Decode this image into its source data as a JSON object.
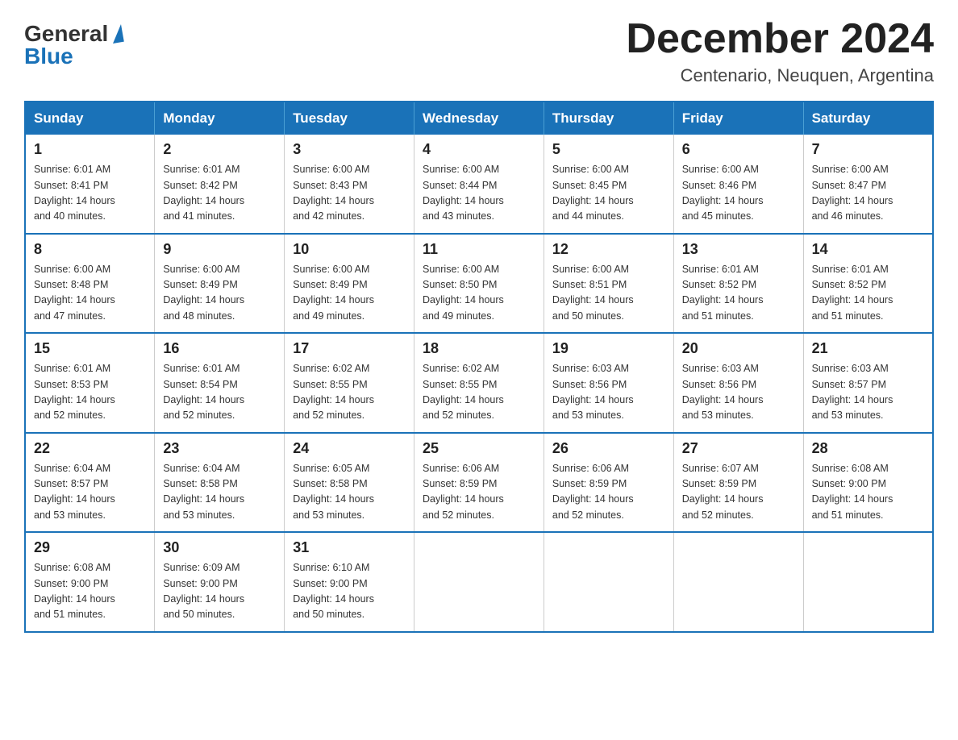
{
  "logo": {
    "general": "General",
    "blue": "Blue"
  },
  "title": "December 2024",
  "subtitle": "Centenario, Neuquen, Argentina",
  "days_of_week": [
    "Sunday",
    "Monday",
    "Tuesday",
    "Wednesday",
    "Thursday",
    "Friday",
    "Saturday"
  ],
  "weeks": [
    [
      {
        "day": "1",
        "sunrise": "6:01 AM",
        "sunset": "8:41 PM",
        "daylight": "14 hours and 40 minutes."
      },
      {
        "day": "2",
        "sunrise": "6:01 AM",
        "sunset": "8:42 PM",
        "daylight": "14 hours and 41 minutes."
      },
      {
        "day": "3",
        "sunrise": "6:00 AM",
        "sunset": "8:43 PM",
        "daylight": "14 hours and 42 minutes."
      },
      {
        "day": "4",
        "sunrise": "6:00 AM",
        "sunset": "8:44 PM",
        "daylight": "14 hours and 43 minutes."
      },
      {
        "day": "5",
        "sunrise": "6:00 AM",
        "sunset": "8:45 PM",
        "daylight": "14 hours and 44 minutes."
      },
      {
        "day": "6",
        "sunrise": "6:00 AM",
        "sunset": "8:46 PM",
        "daylight": "14 hours and 45 minutes."
      },
      {
        "day": "7",
        "sunrise": "6:00 AM",
        "sunset": "8:47 PM",
        "daylight": "14 hours and 46 minutes."
      }
    ],
    [
      {
        "day": "8",
        "sunrise": "6:00 AM",
        "sunset": "8:48 PM",
        "daylight": "14 hours and 47 minutes."
      },
      {
        "day": "9",
        "sunrise": "6:00 AM",
        "sunset": "8:49 PM",
        "daylight": "14 hours and 48 minutes."
      },
      {
        "day": "10",
        "sunrise": "6:00 AM",
        "sunset": "8:49 PM",
        "daylight": "14 hours and 49 minutes."
      },
      {
        "day": "11",
        "sunrise": "6:00 AM",
        "sunset": "8:50 PM",
        "daylight": "14 hours and 49 minutes."
      },
      {
        "day": "12",
        "sunrise": "6:00 AM",
        "sunset": "8:51 PM",
        "daylight": "14 hours and 50 minutes."
      },
      {
        "day": "13",
        "sunrise": "6:01 AM",
        "sunset": "8:52 PM",
        "daylight": "14 hours and 51 minutes."
      },
      {
        "day": "14",
        "sunrise": "6:01 AM",
        "sunset": "8:52 PM",
        "daylight": "14 hours and 51 minutes."
      }
    ],
    [
      {
        "day": "15",
        "sunrise": "6:01 AM",
        "sunset": "8:53 PM",
        "daylight": "14 hours and 52 minutes."
      },
      {
        "day": "16",
        "sunrise": "6:01 AM",
        "sunset": "8:54 PM",
        "daylight": "14 hours and 52 minutes."
      },
      {
        "day": "17",
        "sunrise": "6:02 AM",
        "sunset": "8:55 PM",
        "daylight": "14 hours and 52 minutes."
      },
      {
        "day": "18",
        "sunrise": "6:02 AM",
        "sunset": "8:55 PM",
        "daylight": "14 hours and 52 minutes."
      },
      {
        "day": "19",
        "sunrise": "6:03 AM",
        "sunset": "8:56 PM",
        "daylight": "14 hours and 53 minutes."
      },
      {
        "day": "20",
        "sunrise": "6:03 AM",
        "sunset": "8:56 PM",
        "daylight": "14 hours and 53 minutes."
      },
      {
        "day": "21",
        "sunrise": "6:03 AM",
        "sunset": "8:57 PM",
        "daylight": "14 hours and 53 minutes."
      }
    ],
    [
      {
        "day": "22",
        "sunrise": "6:04 AM",
        "sunset": "8:57 PM",
        "daylight": "14 hours and 53 minutes."
      },
      {
        "day": "23",
        "sunrise": "6:04 AM",
        "sunset": "8:58 PM",
        "daylight": "14 hours and 53 minutes."
      },
      {
        "day": "24",
        "sunrise": "6:05 AM",
        "sunset": "8:58 PM",
        "daylight": "14 hours and 53 minutes."
      },
      {
        "day": "25",
        "sunrise": "6:06 AM",
        "sunset": "8:59 PM",
        "daylight": "14 hours and 52 minutes."
      },
      {
        "day": "26",
        "sunrise": "6:06 AM",
        "sunset": "8:59 PM",
        "daylight": "14 hours and 52 minutes."
      },
      {
        "day": "27",
        "sunrise": "6:07 AM",
        "sunset": "8:59 PM",
        "daylight": "14 hours and 52 minutes."
      },
      {
        "day": "28",
        "sunrise": "6:08 AM",
        "sunset": "9:00 PM",
        "daylight": "14 hours and 51 minutes."
      }
    ],
    [
      {
        "day": "29",
        "sunrise": "6:08 AM",
        "sunset": "9:00 PM",
        "daylight": "14 hours and 51 minutes."
      },
      {
        "day": "30",
        "sunrise": "6:09 AM",
        "sunset": "9:00 PM",
        "daylight": "14 hours and 50 minutes."
      },
      {
        "day": "31",
        "sunrise": "6:10 AM",
        "sunset": "9:00 PM",
        "daylight": "14 hours and 50 minutes."
      },
      null,
      null,
      null,
      null
    ]
  ],
  "labels": {
    "sunrise": "Sunrise:",
    "sunset": "Sunset:",
    "daylight": "Daylight:"
  }
}
